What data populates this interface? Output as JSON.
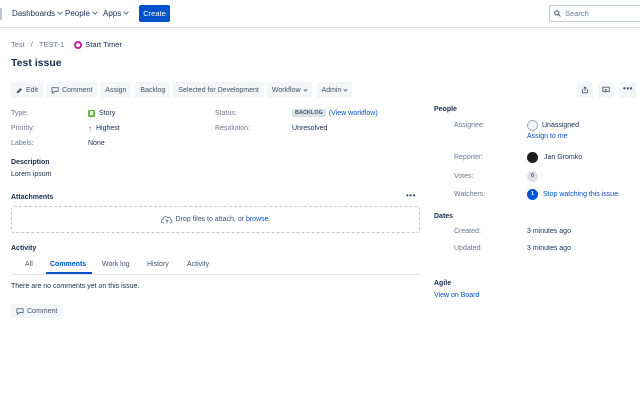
{
  "nav": {
    "dashboards": "Dashboards",
    "people": "People",
    "apps": "Apps",
    "create": "Create",
    "search_placeholder": "Search"
  },
  "breadcrumb": {
    "project": "Test",
    "separator": "/",
    "issue_key": "TEST-1",
    "timer": "Start Timer"
  },
  "issue": {
    "title": "Test issue"
  },
  "toolbar": {
    "edit": "Edit",
    "comment": "Comment",
    "assign": "Assign",
    "backlog": "Backlog",
    "selected_for_dev": "Selected for Development",
    "workflow": "Workflow",
    "admin": "Admin"
  },
  "details": {
    "type_label": "Type:",
    "type_value": "Story",
    "priority_label": "Priority:",
    "priority_value": "Highest",
    "labels_label": "Labels:",
    "labels_value": "None",
    "status_label": "Status:",
    "status_value": "BACKLOG",
    "view_workflow": "(View workflow)",
    "resolution_label": "Resolution:",
    "resolution_value": "Unresolved"
  },
  "description": {
    "heading": "Description",
    "text": "Lorem ipsum"
  },
  "attachments": {
    "heading": "Attachments",
    "drop_text": "Drop files to attach, or",
    "browse": "browse."
  },
  "activity": {
    "heading": "Activity",
    "tabs": [
      "All",
      "Comments",
      "Work log",
      "History",
      "Activity"
    ],
    "active_tab": "Comments",
    "empty": "There are no comments yet on this issue.",
    "comment_button": "Comment"
  },
  "people": {
    "heading": "People",
    "assignee_label": "Assignee:",
    "assignee_value": "Unassigned",
    "assign_to_me": "Assign to me",
    "reporter_label": "Reporter:",
    "reporter_value": "Jan Gromko",
    "votes_label": "Votes:",
    "votes_value": "0",
    "watchers_label": "Watchers:",
    "watchers_count": "1",
    "stop_watching": "Stop watching this issue"
  },
  "dates": {
    "heading": "Dates",
    "created_label": "Created:",
    "created_value": "3 minutes ago",
    "updated_label": "Updated:",
    "updated_value": "3 minutes ago"
  },
  "agile": {
    "heading": "Agile",
    "view_on_board": "View on Board"
  },
  "colors": {
    "primary": "#0052cc",
    "text": "#172b4d",
    "muted": "#6b778c",
    "story": "#65ba43",
    "priority": "#de350b"
  }
}
